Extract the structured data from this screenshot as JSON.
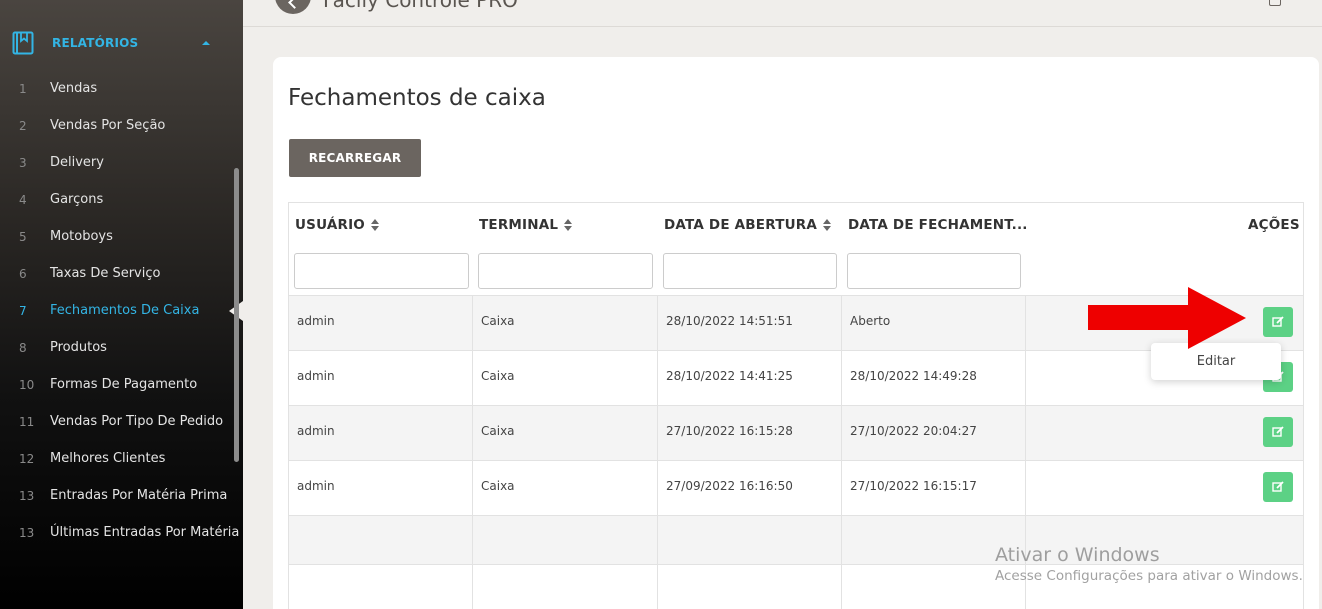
{
  "app": {
    "title": "Facily Controle PRO"
  },
  "sidebar": {
    "section_title": "RELATÓRIOS",
    "items": [
      {
        "num": "1",
        "label": "Vendas"
      },
      {
        "num": "2",
        "label": "Vendas Por Seção"
      },
      {
        "num": "3",
        "label": "Delivery"
      },
      {
        "num": "4",
        "label": "Garçons"
      },
      {
        "num": "5",
        "label": "Motoboys"
      },
      {
        "num": "6",
        "label": "Taxas De Serviço"
      },
      {
        "num": "7",
        "label": "Fechamentos De Caixa",
        "active": true
      },
      {
        "num": "8",
        "label": "Produtos"
      },
      {
        "num": "10",
        "label": "Formas De Pagamento"
      },
      {
        "num": "11",
        "label": "Vendas Por Tipo De Pedido"
      },
      {
        "num": "12",
        "label": "Melhores Clientes"
      },
      {
        "num": "13",
        "label": "Entradas Por Matéria Prima"
      },
      {
        "num": "13",
        "label": "Últimas Entradas Por Matéria Prima"
      }
    ]
  },
  "main": {
    "title": "Fechamentos de caixa",
    "reload_label": "RECARREGAR",
    "columns": [
      "USUÁRIO",
      "TERMINAL",
      "DATA DE ABERTURA",
      "DATA DE FECHAMENT...",
      "AÇÕES"
    ],
    "rows": [
      {
        "usuario": "admin",
        "terminal": "Caixa",
        "abertura": "28/10/2022 14:51:51",
        "fechamento": "Aberto"
      },
      {
        "usuario": "admin",
        "terminal": "Caixa",
        "abertura": "28/10/2022 14:41:25",
        "fechamento": "28/10/2022 14:49:28"
      },
      {
        "usuario": "admin",
        "terminal": "Caixa",
        "abertura": "27/10/2022 16:15:28",
        "fechamento": "27/10/2022 20:04:27"
      },
      {
        "usuario": "admin",
        "terminal": "Caixa",
        "abertura": "27/09/2022 16:16:50",
        "fechamento": "27/10/2022 16:15:17"
      }
    ],
    "tooltip": "Editar",
    "edit_button_color": "#5cd185"
  },
  "watermark": {
    "line1": "Ativar o Windows",
    "line2": "Acesse Configurações para ativar o Windows."
  },
  "colors": {
    "accent": "#33b5e5",
    "button_dark": "#6b6560",
    "arrow": "#ee0000"
  }
}
